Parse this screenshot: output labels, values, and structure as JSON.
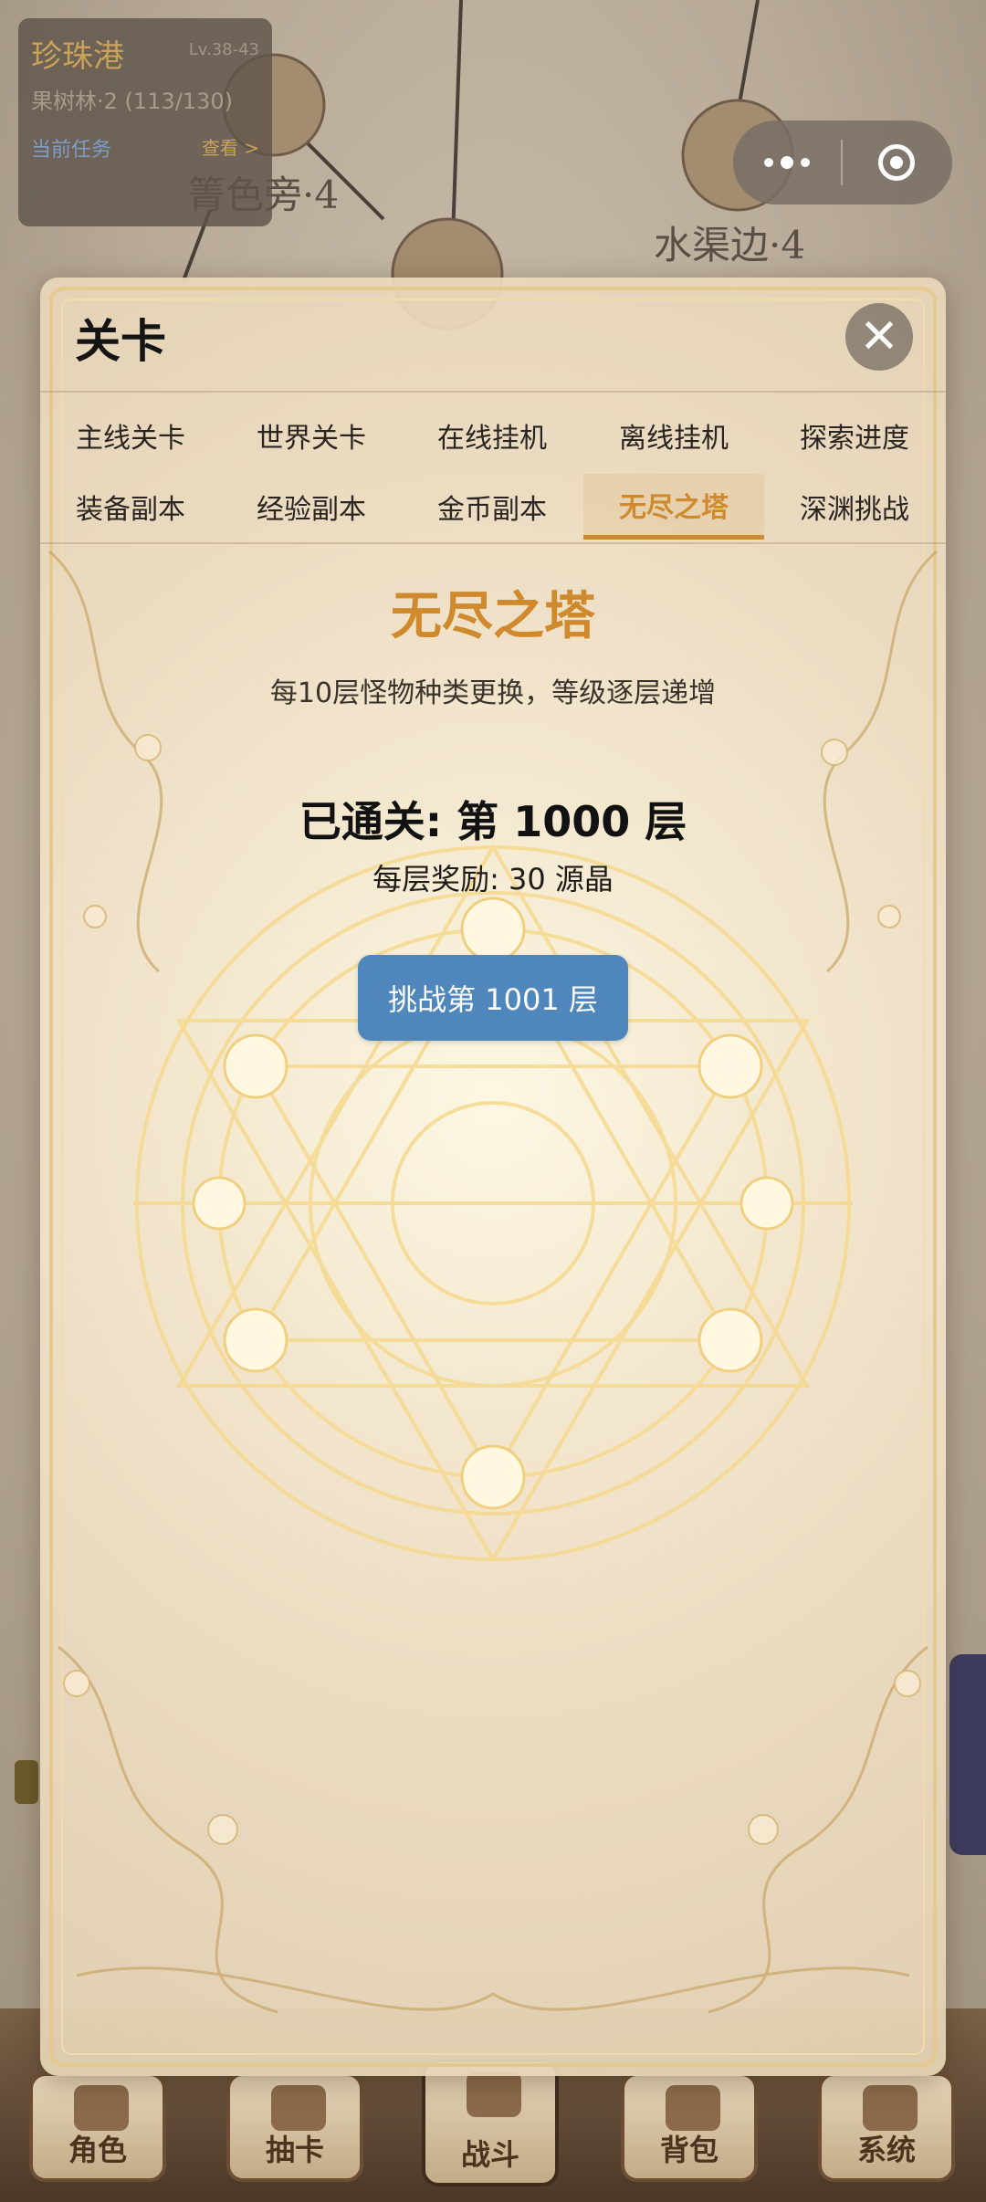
{
  "map": {
    "node_labels": [
      "箐色旁·4",
      "水渠边·4"
    ]
  },
  "location_card": {
    "name": "珍珠港",
    "level": "Lv.38-43",
    "subtitle": "果树林·2 (113/130)",
    "task_label": "当前任务",
    "view_label": "查看 >"
  },
  "capsule": {
    "more_icon": "more-dots-icon",
    "close_icon": "target-circle-icon"
  },
  "modal": {
    "title": "关卡",
    "close_glyph": "✕",
    "tabs_row1": [
      "主线关卡",
      "世界关卡",
      "在线挂机",
      "离线挂机",
      "探索进度"
    ],
    "tabs_row2": [
      "装备副本",
      "经验副本",
      "金币副本",
      "无尽之塔",
      "深渊挑战"
    ],
    "active_tab": "无尽之塔",
    "tower": {
      "title": "无尽之塔",
      "description": "每10层怪物种类更换，等级逐层递增",
      "cleared": "已通关: 第 1000 层",
      "reward": "每层奖励: 30 源晶",
      "challenge_button": "挑战第 1001 层"
    }
  },
  "bottom_nav": {
    "items": [
      "角色",
      "抽卡",
      "战斗",
      "背包",
      "系统"
    ],
    "active": "战斗"
  },
  "colors": {
    "accent": "#d08a2e",
    "button": "#4f87bd",
    "title_text": "#141414"
  }
}
